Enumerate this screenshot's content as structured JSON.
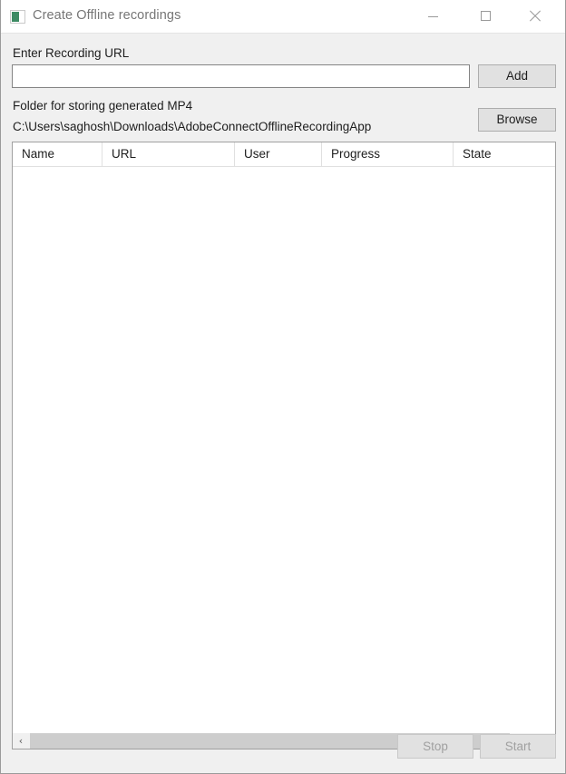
{
  "window": {
    "title": "Create Offline recordings",
    "icon": "app-window-icon",
    "controls": {
      "minimize": "minimize-icon",
      "maximize": "maximize-icon",
      "close": "close-icon"
    }
  },
  "form": {
    "url_label": "Enter Recording URL",
    "url_value": "",
    "url_placeholder": "",
    "add_button": "Add",
    "folder_label": "Folder for storing generated MP4",
    "folder_path": "C:\\Users\\saghosh\\Downloads\\AdobeConnectOfflineRecordingApp",
    "browse_button": "Browse"
  },
  "table": {
    "columns": [
      {
        "label": "Name"
      },
      {
        "label": "URL"
      },
      {
        "label": "User"
      },
      {
        "label": "Progress"
      },
      {
        "label": "State"
      }
    ],
    "rows": []
  },
  "scrollbar": {
    "left_arrow": "‹",
    "right_arrow": "›"
  },
  "footer": {
    "stop_button": "Stop",
    "start_button": "Start"
  },
  "colors": {
    "accent_icon": "#3c8a63",
    "window_bg": "#f0f0f0",
    "titlebar_bg": "#ffffff",
    "title_text": "#767676",
    "text": "#1d1d1d",
    "disabled_text": "#a0a0a0",
    "button_face": "#e1e1e1",
    "button_border": "#adadad",
    "field_border": "#848484",
    "scroll_thumb": "#cdcdcd"
  }
}
